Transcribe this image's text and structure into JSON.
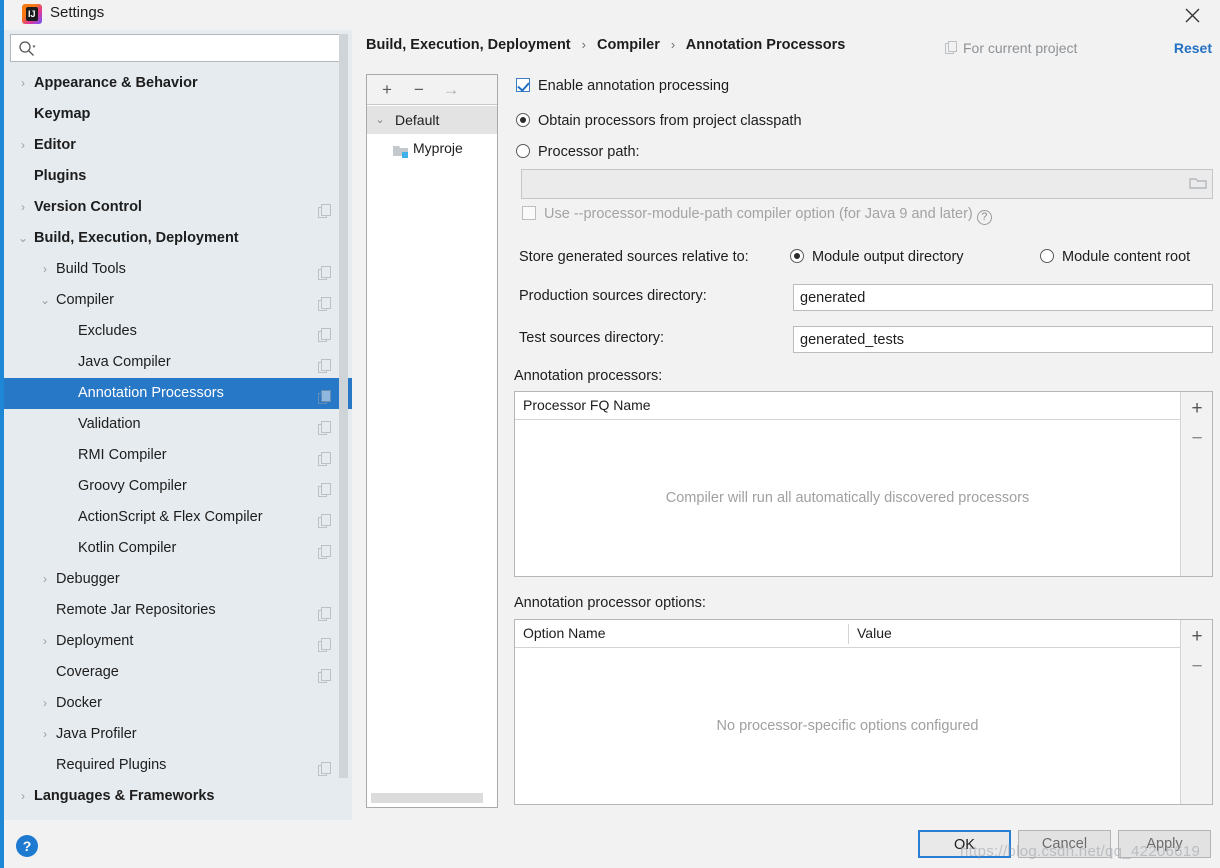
{
  "window": {
    "title": "Settings",
    "app_icon": "intellij-idea-icon",
    "close_icon": "close-icon"
  },
  "search": {
    "placeholder": "",
    "value": "",
    "icon": "search-icon"
  },
  "sidebar": {
    "items": [
      {
        "label": "Appearance & Behavior",
        "indent": 0,
        "arrow": "›",
        "bold": true,
        "badge": false,
        "selected": false
      },
      {
        "label": "Keymap",
        "indent": 0,
        "arrow": "",
        "bold": true,
        "badge": false,
        "selected": false
      },
      {
        "label": "Editor",
        "indent": 0,
        "arrow": "›",
        "bold": true,
        "badge": false,
        "selected": false
      },
      {
        "label": "Plugins",
        "indent": 0,
        "arrow": "",
        "bold": true,
        "badge": false,
        "selected": false
      },
      {
        "label": "Version Control",
        "indent": 0,
        "arrow": "›",
        "bold": true,
        "badge": true,
        "selected": false
      },
      {
        "label": "Build, Execution, Deployment",
        "indent": 0,
        "arrow": "⌄",
        "bold": true,
        "badge": false,
        "selected": false
      },
      {
        "label": "Build Tools",
        "indent": 1,
        "arrow": "›",
        "bold": false,
        "badge": true,
        "selected": false
      },
      {
        "label": "Compiler",
        "indent": 1,
        "arrow": "⌄",
        "bold": false,
        "badge": true,
        "selected": false
      },
      {
        "label": "Excludes",
        "indent": 2,
        "arrow": "",
        "bold": false,
        "badge": true,
        "selected": false
      },
      {
        "label": "Java Compiler",
        "indent": 2,
        "arrow": "",
        "bold": false,
        "badge": true,
        "selected": false
      },
      {
        "label": "Annotation Processors",
        "indent": 2,
        "arrow": "",
        "bold": false,
        "badge": true,
        "selected": true
      },
      {
        "label": "Validation",
        "indent": 2,
        "arrow": "",
        "bold": false,
        "badge": true,
        "selected": false
      },
      {
        "label": "RMI Compiler",
        "indent": 2,
        "arrow": "",
        "bold": false,
        "badge": true,
        "selected": false
      },
      {
        "label": "Groovy Compiler",
        "indent": 2,
        "arrow": "",
        "bold": false,
        "badge": true,
        "selected": false
      },
      {
        "label": "ActionScript & Flex Compiler",
        "indent": 2,
        "arrow": "",
        "bold": false,
        "badge": true,
        "selected": false
      },
      {
        "label": "Kotlin Compiler",
        "indent": 2,
        "arrow": "",
        "bold": false,
        "badge": true,
        "selected": false
      },
      {
        "label": "Debugger",
        "indent": 1,
        "arrow": "›",
        "bold": false,
        "badge": false,
        "selected": false
      },
      {
        "label": "Remote Jar Repositories",
        "indent": 1,
        "arrow": "",
        "bold": false,
        "badge": true,
        "selected": false
      },
      {
        "label": "Deployment",
        "indent": 1,
        "arrow": "›",
        "bold": false,
        "badge": true,
        "selected": false
      },
      {
        "label": "Coverage",
        "indent": 1,
        "arrow": "",
        "bold": false,
        "badge": true,
        "selected": false
      },
      {
        "label": "Docker",
        "indent": 1,
        "arrow": "›",
        "bold": false,
        "badge": false,
        "selected": false
      },
      {
        "label": "Java Profiler",
        "indent": 1,
        "arrow": "›",
        "bold": false,
        "badge": false,
        "selected": false
      },
      {
        "label": "Required Plugins",
        "indent": 1,
        "arrow": "",
        "bold": false,
        "badge": true,
        "selected": false
      },
      {
        "label": "Languages & Frameworks",
        "indent": 0,
        "arrow": "›",
        "bold": true,
        "badge": false,
        "selected": false
      }
    ]
  },
  "module_panel": {
    "toolbar": {
      "add": "+",
      "remove": "−",
      "move": "→"
    },
    "rows": [
      {
        "label": "Default",
        "arrow": "⌄",
        "child": false,
        "header": true
      },
      {
        "label": "Myproje",
        "arrow": "",
        "child": true,
        "header": false
      }
    ]
  },
  "header": {
    "breadcrumb": [
      "Build, Execution, Deployment",
      "Compiler",
      "Annotation Processors"
    ],
    "separator": "›",
    "for_current_project": "For current project",
    "reset_label": "Reset"
  },
  "content": {
    "enable_annotation_processing": "Enable annotation processing",
    "enable_checked": true,
    "obtain_from_classpath": "Obtain processors from project classpath",
    "obtain_selected": true,
    "processor_path_label": "Processor path:",
    "processor_path_selected": false,
    "processor_path_value": "",
    "browse_icon": "folder-icon",
    "module_path_option": "Use --processor-module-path compiler option (for Java 9 and later)",
    "module_path_checked": false,
    "module_path_help_icon": "help-icon",
    "store_relative_label": "Store generated sources relative to:",
    "store_option_output": "Module output directory",
    "store_option_content_root": "Module content root",
    "store_selected": "Module output directory",
    "production_label": "Production sources directory:",
    "production_value": "generated",
    "test_label": "Test sources directory:",
    "test_value": "generated_tests",
    "processors_section_label": "Annotation processors:",
    "processors_table": {
      "columns": [
        "Processor FQ Name"
      ],
      "rows": [],
      "empty_text": "Compiler will run all automatically discovered processors",
      "add_button": "+",
      "remove_button": "−"
    },
    "options_section_label": "Annotation processor options:",
    "options_table": {
      "columns": [
        "Option Name",
        "Value"
      ],
      "rows": [],
      "empty_text": "No processor-specific options configured",
      "add_button": "+",
      "remove_button": "−"
    }
  },
  "footer": {
    "help_icon": "help-icon",
    "ok_label": "OK",
    "cancel_label": "Cancel",
    "apply_label": "Apply"
  },
  "watermark": {
    "text": "https://blog.csdn.net/qq_42206619"
  },
  "colors": {
    "accent": "#1e88d6",
    "selection": "#2878c8",
    "sidebar_bg": "#e6ebef",
    "dialog_bg": "#f2f2f2",
    "link": "#2470c2",
    "muted": "#a0a0a0"
  }
}
